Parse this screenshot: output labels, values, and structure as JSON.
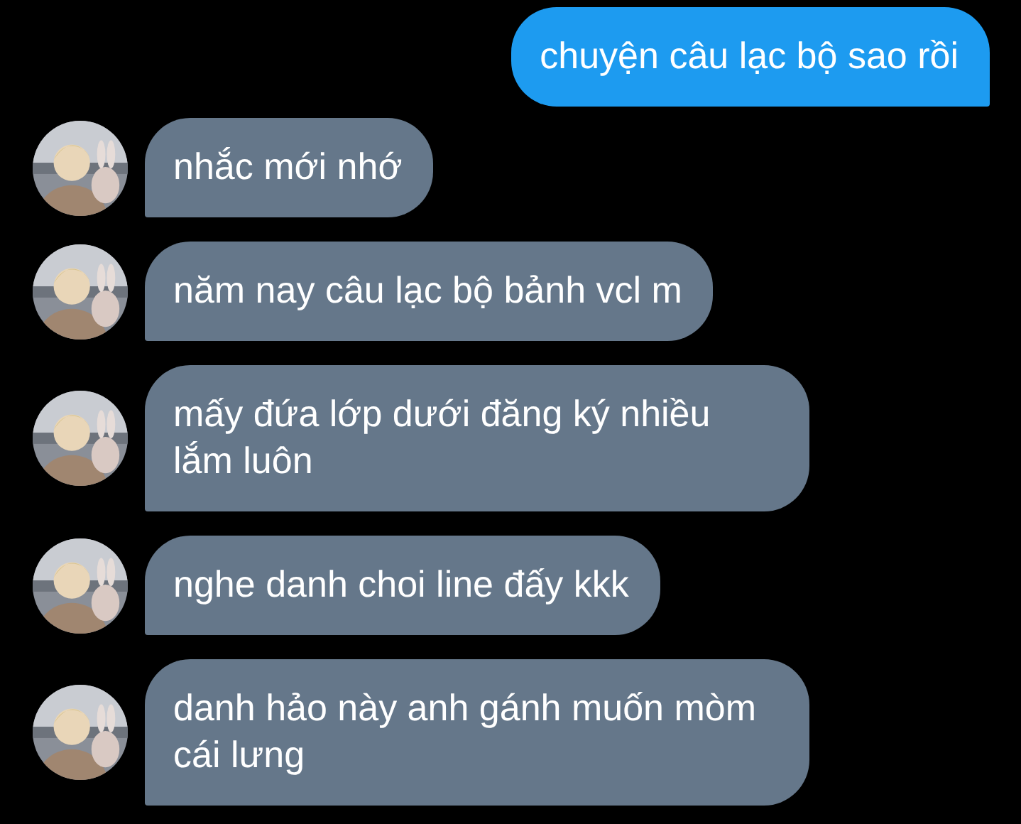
{
  "messages": [
    {
      "kind": "sent",
      "text": "chuyện câu lạc bộ sao rồi"
    },
    {
      "kind": "received",
      "text": "nhắc mới nhớ"
    },
    {
      "kind": "received",
      "text": "năm nay câu lạc bộ bảnh vcl m"
    },
    {
      "kind": "received",
      "text": "mấy đứa lớp dưới đăng ký nhiều lắm luôn"
    },
    {
      "kind": "received",
      "text": "nghe danh choi line đấy kkk"
    },
    {
      "kind": "received",
      "text": "danh hảo này anh gánh muốn mòm cái lưng"
    }
  ]
}
